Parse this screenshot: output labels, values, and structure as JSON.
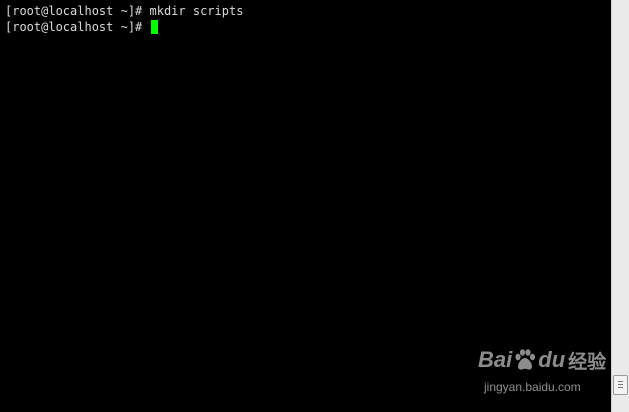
{
  "terminal": {
    "lines": [
      {
        "prompt": "[root@localhost ~]#",
        "command": " mkdir scripts"
      },
      {
        "prompt": "[root@localhost ~]#",
        "command": " "
      }
    ],
    "cursor_color": "#00ff00",
    "background": "#000000",
    "text_color": "#d9d9d9"
  },
  "scrollbar": {
    "thumb_icon": "grip-lines-icon"
  },
  "watermark": {
    "brand_left": "Bai",
    "brand_right": "du",
    "paw_icon": "baidu-paw-icon",
    "product": "经验",
    "url": "jingyan.baidu.com"
  }
}
